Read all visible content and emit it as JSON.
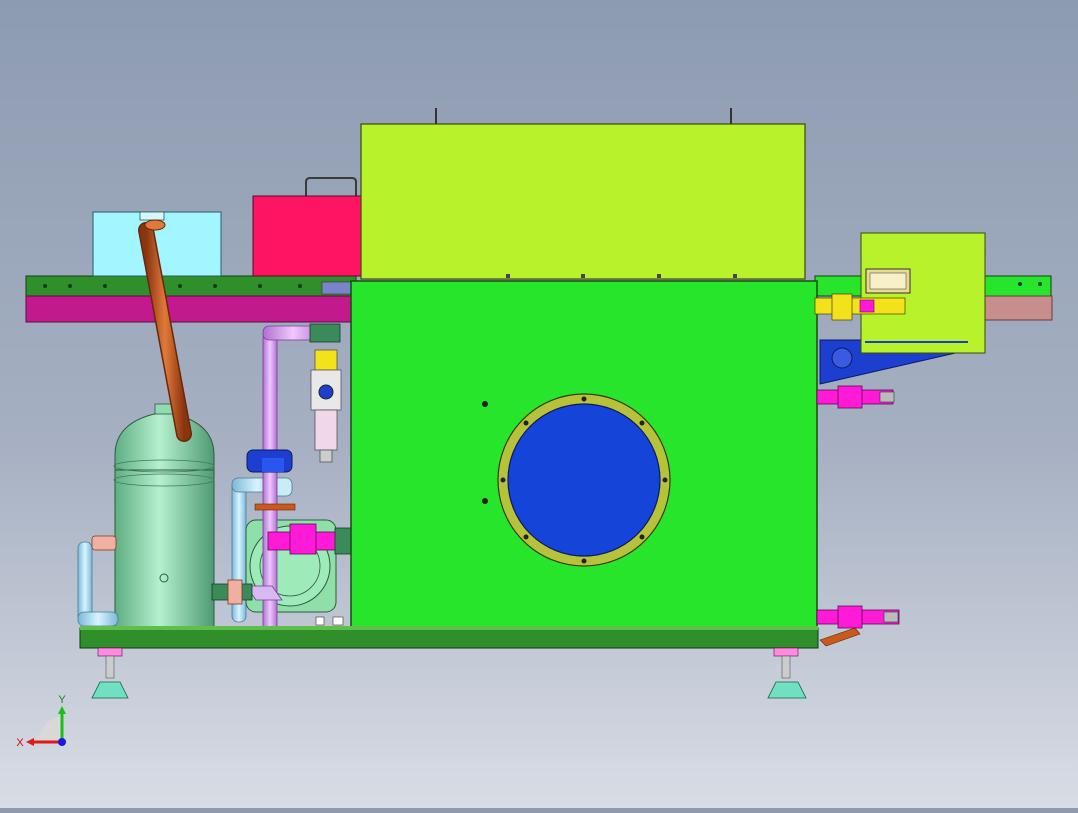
{
  "viewport": {
    "background_top": "#8d9bb1",
    "background_bottom": "#d9dde5"
  },
  "colors": {
    "upper_cover": "#b8f22a",
    "main_tank": "#27e52a",
    "red_box": "#ff1463",
    "cyan_box": "#a3f5ff",
    "frame_rail": "#2f8f2a",
    "magenta_rail": "#c21a8c",
    "port_window": "#1545d8",
    "port_ring": "#b6c23a",
    "accumulator": "#8fdcb0",
    "copper_pipe": "#c85a1e",
    "side_panel": "#b8f22a",
    "bracket_blue": "#1d3fd0",
    "fitting_magenta": "#ff1ad8",
    "fitting_yellow": "#f2e21a",
    "base_plate": "#2f8f2a",
    "foot": "#70e0c0"
  },
  "triad": {
    "x_label": "X",
    "y_label": "Y",
    "x_color": "#e01818",
    "y_color": "#18c018",
    "z_color": "#1818e0"
  },
  "icons": [
    "coordinate-triad-icon"
  ]
}
